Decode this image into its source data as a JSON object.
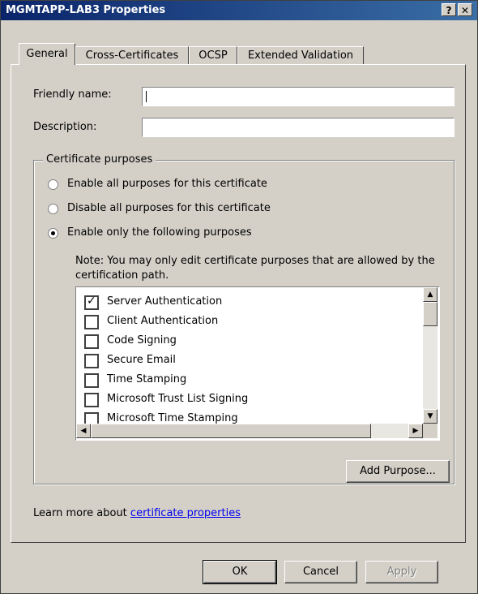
{
  "window": {
    "title": "MGMTAPP-LAB3 Properties",
    "help_button": "?",
    "close_button": "✕"
  },
  "tabs": [
    {
      "label": "General",
      "active": true
    },
    {
      "label": "Cross-Certificates",
      "active": false
    },
    {
      "label": "OCSP",
      "active": false
    },
    {
      "label": "Extended Validation",
      "active": false
    }
  ],
  "general": {
    "friendly_name_label": "Friendly name:",
    "friendly_name_value": "",
    "description_label": "Description:",
    "description_value": ""
  },
  "purposes": {
    "group_title": "Certificate purposes",
    "options": [
      {
        "label": "Enable all purposes for this certificate",
        "selected": false
      },
      {
        "label": "Disable all purposes for this certificate",
        "selected": false
      },
      {
        "label": "Enable only the following purposes",
        "selected": true
      }
    ],
    "note": "Note: You may only edit certificate purposes that are allowed by the certification path.",
    "items": [
      {
        "label": "Server Authentication",
        "checked": true
      },
      {
        "label": "Client Authentication",
        "checked": false
      },
      {
        "label": "Code Signing",
        "checked": false
      },
      {
        "label": "Secure Email",
        "checked": false
      },
      {
        "label": "Time Stamping",
        "checked": false
      },
      {
        "label": "Microsoft Trust List Signing",
        "checked": false
      },
      {
        "label": "Microsoft Time Stamping",
        "checked": false
      }
    ],
    "add_purpose_label": "Add Purpose..."
  },
  "learn_more": {
    "prefix": "Learn more about ",
    "link_text": "certificate properties"
  },
  "buttons": {
    "ok": "OK",
    "cancel": "Cancel",
    "apply": "Apply"
  }
}
